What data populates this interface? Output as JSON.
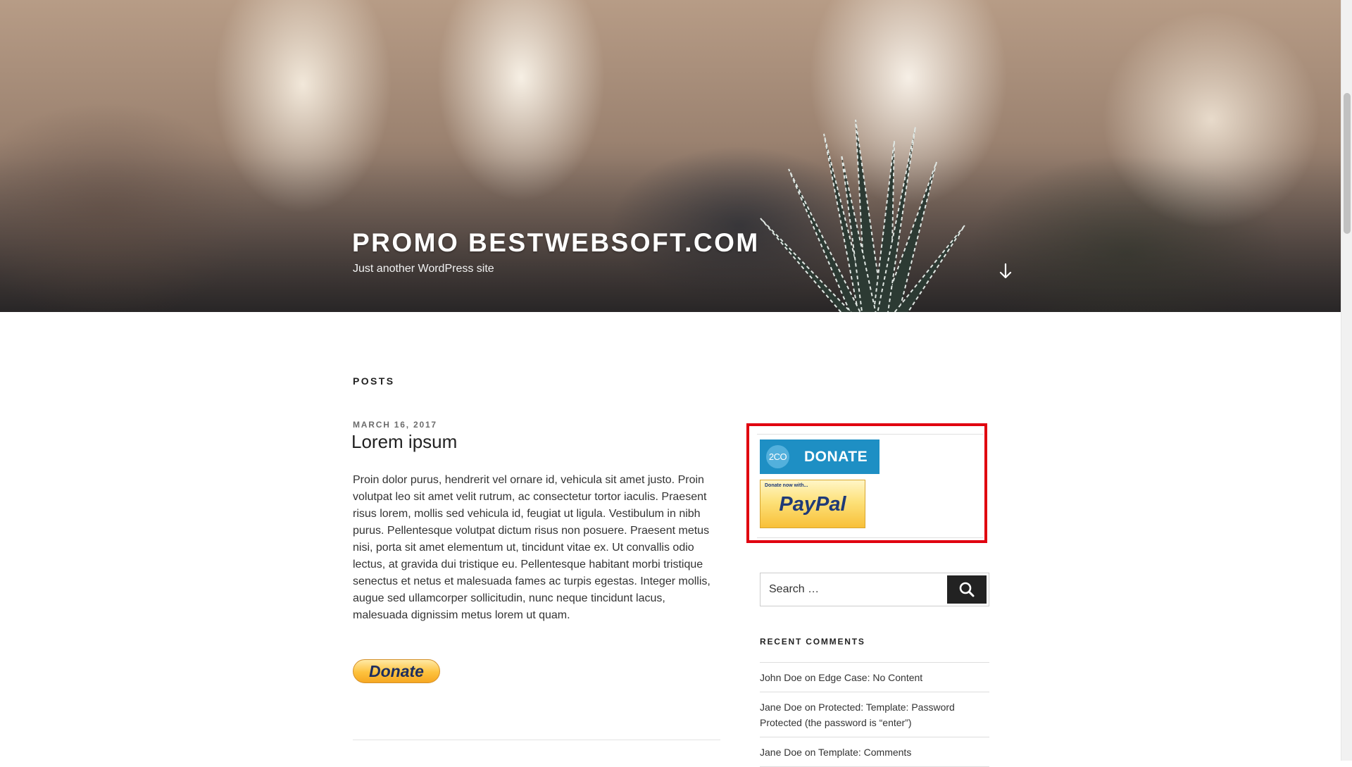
{
  "header": {
    "site_title": "PROMO BESTWEBSOFT.COM",
    "tagline": "Just another WordPress site",
    "scroll_icon": "arrow-down-icon"
  },
  "main": {
    "section_heading": "POSTS",
    "post": {
      "date": "MARCH 16, 2017",
      "title": "Lorem ipsum",
      "body": "Proin dolor purus, hendrerit vel ornare id, vehicula sit amet justo. Proin volutpat leo sit amet velit rutrum, ac consectetur tortor iaculis. Praesent risus lorem, mollis sed vehicula id, feugiat ut ligula. Vestibulum in nibh purus. Pellentesque volutpat dictum risus non posuere. Praesent metus nisi, porta sit amet elementum ut, tincidunt vitae ex. Ut convallis odio lectus, at gravida dui tristique eu. Pellentesque habitant morbi tristique senectus et netus et malesuada fames ac turpis egestas. Integer mollis, augue sed ullamcorper sollicitudin, nunc neque tincidunt lacus, malesuada dignissim metus lorem ut quam.",
      "donate_button": "Donate"
    }
  },
  "sidebar": {
    "donate_widget": {
      "checkout_logo": "2CO",
      "checkout_label": "DONATE",
      "paypal_small": "Donate now with...",
      "paypal_logo": "PayPal"
    },
    "search": {
      "placeholder": "Search …",
      "button_icon": "search-icon"
    },
    "recent_comments": {
      "heading": "RECENT COMMENTS",
      "connector": "on",
      "items": [
        {
          "author": "John Doe",
          "post": "Edge Case: No Content"
        },
        {
          "author": "Jane Doe",
          "post": "Protected: Template: Password Protected (the password is “enter”)"
        },
        {
          "author": "Jane Doe",
          "post": "Template: Comments"
        }
      ]
    }
  },
  "colors": {
    "highlight_border": "#e0000f",
    "checkout_blue": "#1e8fc4",
    "paypal_gold": "#fdc23d",
    "search_button": "#222222"
  }
}
